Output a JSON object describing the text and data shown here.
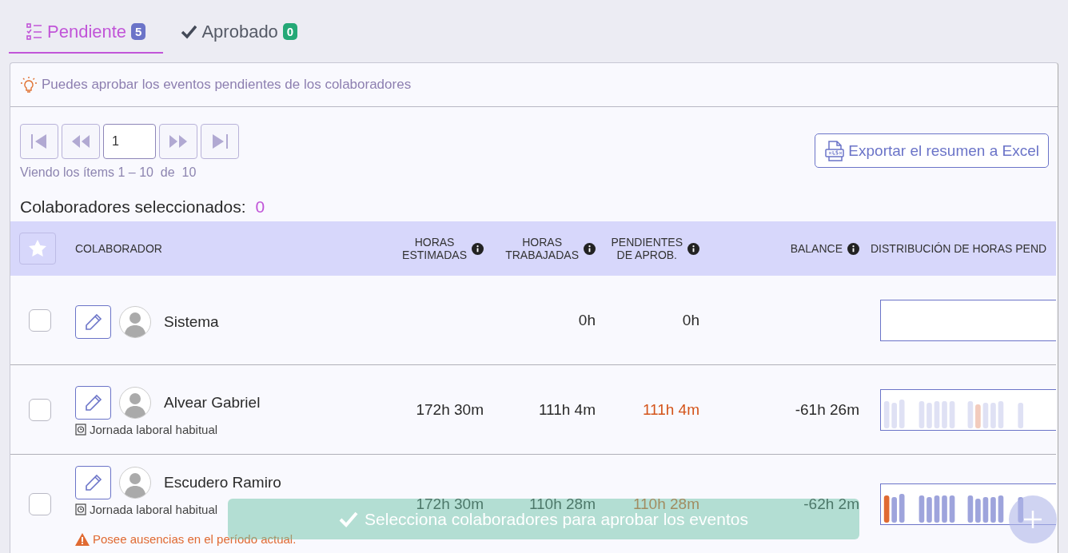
{
  "tabs": [
    {
      "label": "Pendiente",
      "count": "5",
      "selected": true
    },
    {
      "label": "Aprobado",
      "count": "0",
      "selected": false
    }
  ],
  "hint": "Puedes aprobar los eventos pendientes de los colaboradores",
  "pager": {
    "page": "1",
    "summary": "Viendo los ítems 1 – 10  de  10"
  },
  "export_button": "Exportar el resumen a Excel",
  "selected_label": "Colaboradores seleccionados:",
  "selected_count": "0",
  "columns": [
    {
      "label": "COLABORADOR",
      "info": false
    },
    {
      "label": "HORAS\nESTIMADAS",
      "info": true
    },
    {
      "label": "HORAS\nTRABAJADAS",
      "info": true
    },
    {
      "label": "PENDIENTES\nDE APROB.",
      "info": true
    },
    {
      "label": "BALANCE",
      "info": true
    },
    {
      "label": "DISTRIBUCIÓN DE HORAS PEND",
      "info": false
    }
  ],
  "rows": [
    {
      "name": "Sistema",
      "selected": false,
      "worked": "0h",
      "pending": "0h",
      "pending_alert": false,
      "kind": "empty"
    },
    {
      "name": "Alvear Gabriel",
      "selected": false,
      "schedule": "Jornada laboral habitual",
      "estimated": "172h 30m",
      "worked": "111h 4m",
      "pending": "111h 4m",
      "pending_alert": true,
      "balance": "-61h 26m",
      "kind": "faded"
    },
    {
      "name": "Escudero Ramiro",
      "selected": false,
      "schedule": "Jornada laboral habitual",
      "warning": "Posee ausencias en el período actual.",
      "estimated": "172h 30m",
      "worked": "110h 28m",
      "pending": "110h 28m",
      "pending_alert": true,
      "balance": "-62h 2m",
      "kind": "full"
    }
  ],
  "toast": "Selecciona colaboradores para aprobar los eventos"
}
